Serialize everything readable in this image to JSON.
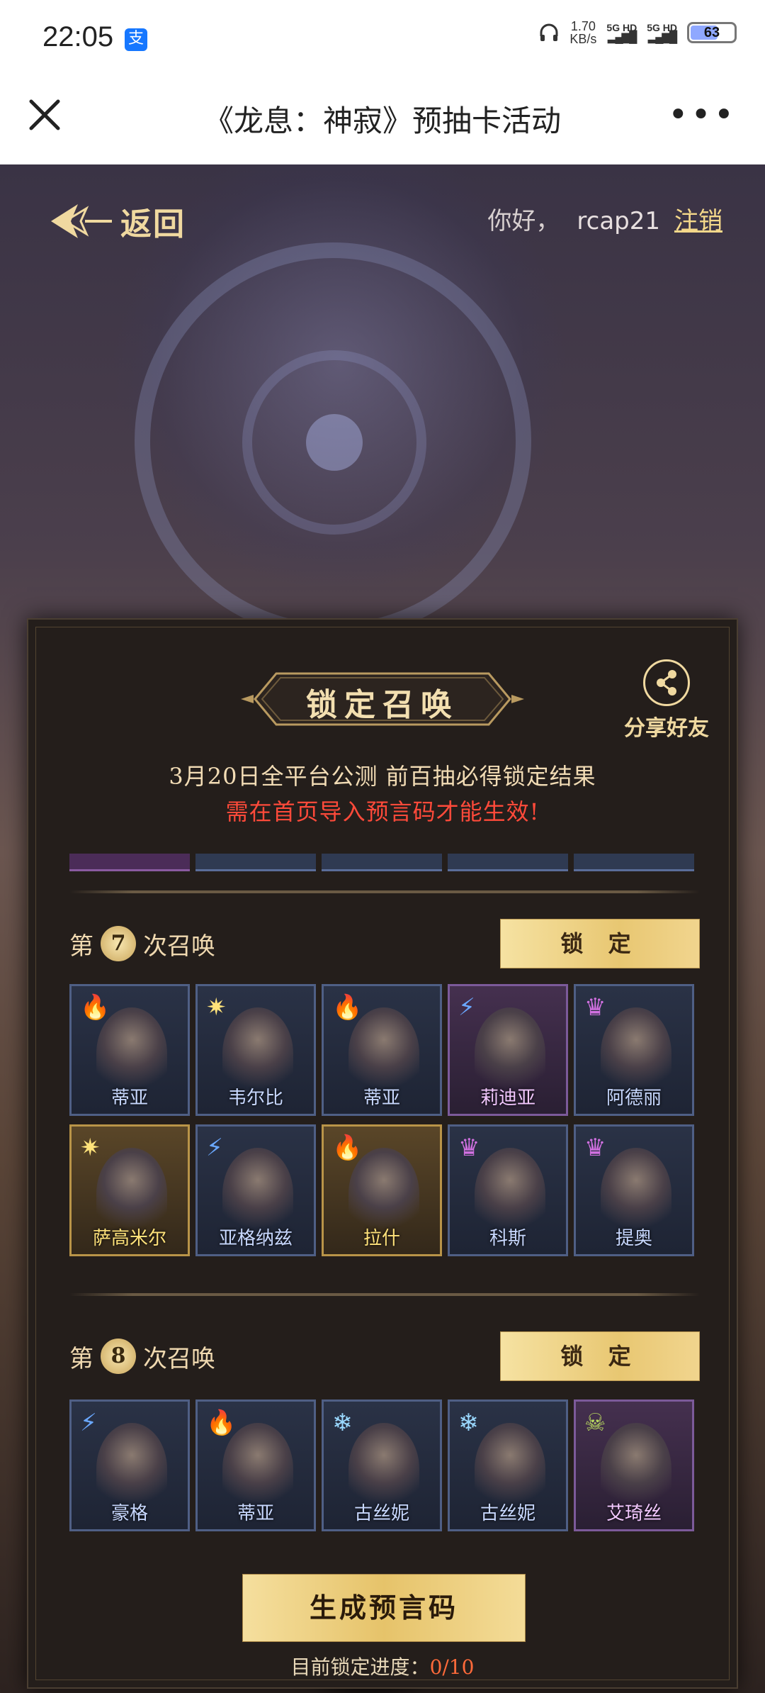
{
  "status_bar": {
    "time": "22:05",
    "pay_icon": "支",
    "net_speed_value": "1.70",
    "net_speed_unit": "KB/s",
    "sim1": "5G HD",
    "sim2": "5G HD",
    "battery": "63"
  },
  "title_bar": {
    "title": "《龙息：神寂》预抽卡活动"
  },
  "header": {
    "back_label": "返回",
    "greeting": "你好，",
    "username": "rcap21",
    "logout": "注销"
  },
  "panel": {
    "title": "锁定召唤",
    "share_label": "分享好友",
    "notice_1": "3月20日全平台公测 前百抽必得锁定结果",
    "notice_2": "需在首页导入预言码才能生效!",
    "rounds": [
      {
        "prefix": "第",
        "number": "7",
        "suffix": "次召唤",
        "lock_label": "锁 定",
        "cards": [
          {
            "name": "蒂亚",
            "element": "🔥",
            "element_name": "fire",
            "rarity": "blue"
          },
          {
            "name": "韦尔比",
            "element": "✷",
            "element_name": "light",
            "rarity": "blue"
          },
          {
            "name": "蒂亚",
            "element": "🔥",
            "element_name": "fire",
            "rarity": "blue"
          },
          {
            "name": "莉迪亚",
            "element": "⚡",
            "element_name": "lightning",
            "rarity": "purple"
          },
          {
            "name": "阿德丽",
            "element": "♛",
            "element_name": "dark",
            "rarity": "blue"
          },
          {
            "name": "萨高米尔",
            "element": "✷",
            "element_name": "light",
            "rarity": "gold"
          },
          {
            "name": "亚格纳兹",
            "element": "⚡",
            "element_name": "lightning",
            "rarity": "blue"
          },
          {
            "name": "拉什",
            "element": "🔥",
            "element_name": "fire",
            "rarity": "gold"
          },
          {
            "name": "科斯",
            "element": "♛",
            "element_name": "dark",
            "rarity": "blue"
          },
          {
            "name": "提奥",
            "element": "♛",
            "element_name": "dark",
            "rarity": "blue"
          }
        ]
      },
      {
        "prefix": "第",
        "number": "8",
        "suffix": "次召唤",
        "lock_label": "锁 定",
        "cards": [
          {
            "name": "豪格",
            "element": "⚡",
            "element_name": "lightning",
            "rarity": "blue"
          },
          {
            "name": "蒂亚",
            "element": "🔥",
            "element_name": "fire",
            "rarity": "blue"
          },
          {
            "name": "古丝妮",
            "element": "❄",
            "element_name": "ice",
            "rarity": "blue"
          },
          {
            "name": "古丝妮",
            "element": "❄",
            "element_name": "ice",
            "rarity": "blue"
          },
          {
            "name": "艾琦丝",
            "element": "☠",
            "element_name": "poison",
            "rarity": "purple"
          }
        ]
      }
    ],
    "generate_button": "生成预言码",
    "progress_label": "目前锁定进度：",
    "progress_value": "0/10"
  },
  "colors": {
    "accent_gold": "#e8c772",
    "warning_red": "#ff4a3a",
    "panel_bg": "#241e1b"
  }
}
